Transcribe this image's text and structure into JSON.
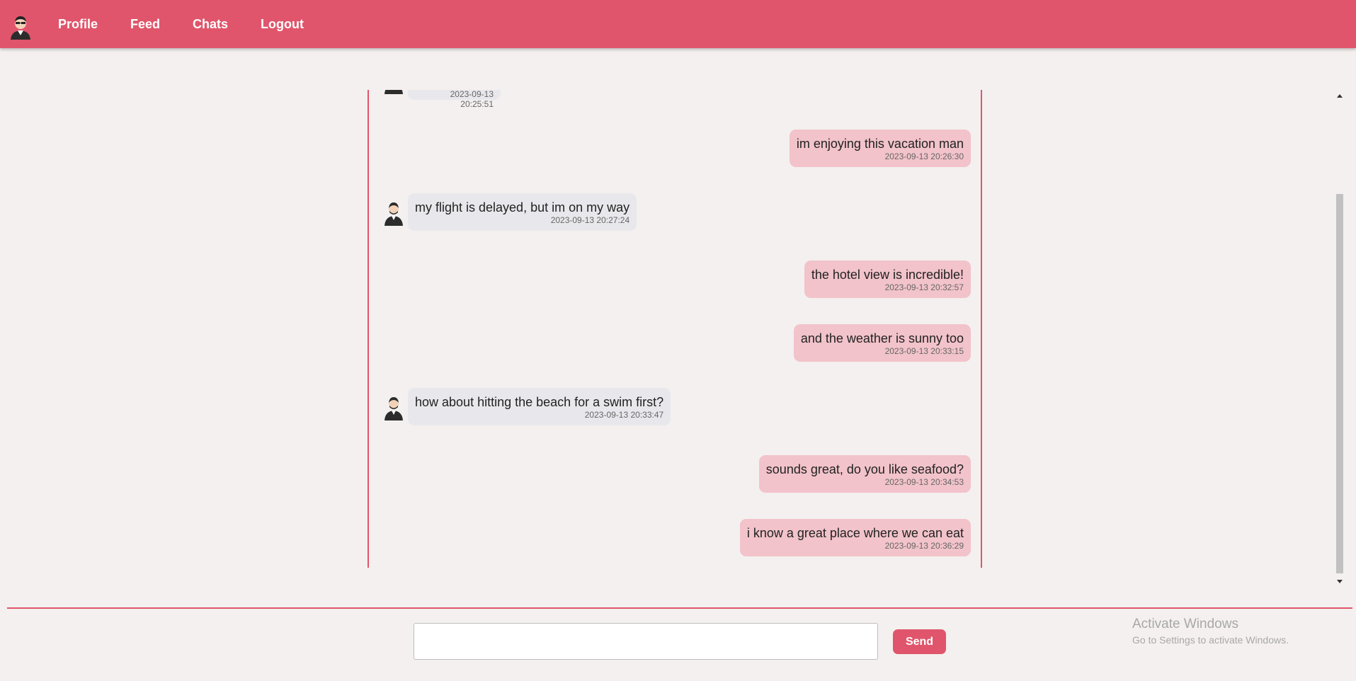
{
  "nav": {
    "avatar_icon": "user-avatar-icon",
    "links": [
      "Profile",
      "Feed",
      "Chats",
      "Logout"
    ]
  },
  "chat": {
    "partial_time": "2023-09-13 20:25:51",
    "messages": [
      {
        "side": "out",
        "text": "im enjoying this vacation man",
        "time": "2023-09-13 20:26:30"
      },
      {
        "side": "in",
        "text": "my flight is delayed, but im on my way",
        "time": "2023-09-13 20:27:24"
      },
      {
        "side": "out",
        "text": "the hotel view is incredible!",
        "time": "2023-09-13 20:32:57"
      },
      {
        "side": "out",
        "text": "and the weather is sunny too",
        "time": "2023-09-13 20:33:15"
      },
      {
        "side": "in",
        "text": "how about hitting the beach for a swim first?",
        "time": "2023-09-13 20:33:47"
      },
      {
        "side": "out",
        "text": "sounds great, do you like seafood?",
        "time": "2023-09-13 20:34:53"
      },
      {
        "side": "out",
        "text": "i know a great place where we can eat",
        "time": "2023-09-13 20:36:29"
      }
    ]
  },
  "composer": {
    "input_value": "",
    "input_placeholder": "",
    "send_label": "Send"
  },
  "watermark": {
    "title": "Activate Windows",
    "subtitle": "Go to Settings to activate Windows."
  },
  "colors": {
    "accent": "#e0556b",
    "outgoing_bubble": "#f2c3ca",
    "incoming_bubble": "#e8e8ec",
    "background": "#f4f0ef"
  }
}
